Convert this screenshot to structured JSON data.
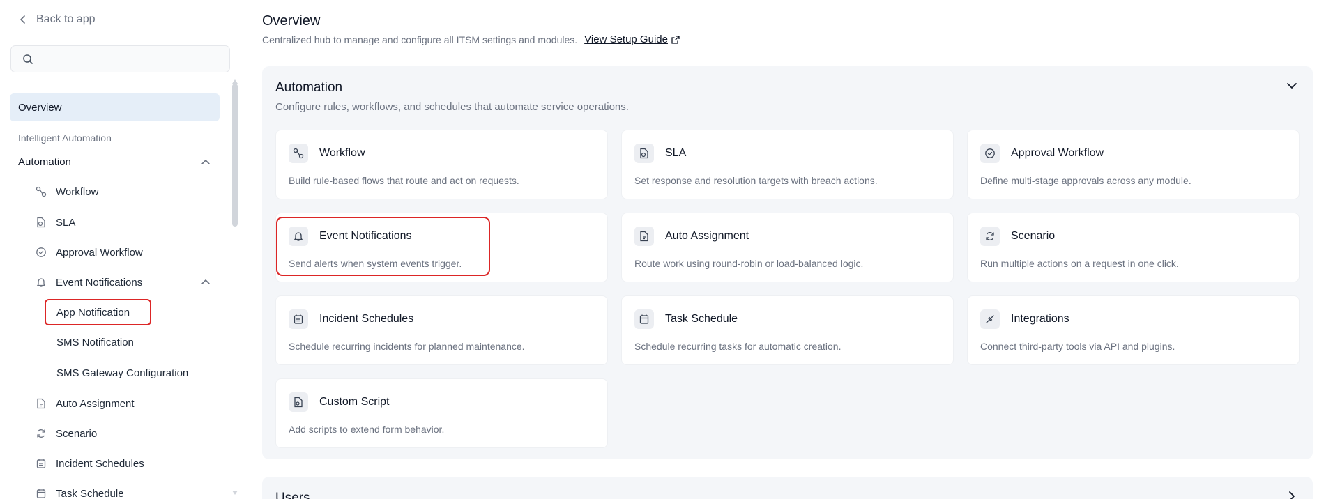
{
  "sidebar": {
    "back_label": "Back to app",
    "search_placeholder": "",
    "overview_label": "Overview",
    "section_label": "Intelligent Automation",
    "group_label": "Automation",
    "items": [
      {
        "label": "Workflow",
        "icon": "workflow-icon"
      },
      {
        "label": "SLA",
        "icon": "sla-icon"
      },
      {
        "label": "Approval Workflow",
        "icon": "approval-icon"
      },
      {
        "label": "Event Notifications",
        "icon": "bell-icon"
      },
      {
        "label": "Auto Assignment",
        "icon": "auto-assign-icon"
      },
      {
        "label": "Scenario",
        "icon": "refresh-icon"
      },
      {
        "label": "Incident Schedules",
        "icon": "calendar-list-icon"
      },
      {
        "label": "Task Schedule",
        "icon": "calendar-icon"
      }
    ],
    "sub_items": [
      {
        "label": "App Notification"
      },
      {
        "label": "SMS Notification"
      },
      {
        "label": "SMS Gateway Configuration"
      }
    ]
  },
  "main": {
    "title": "Overview",
    "subtitle": "Centralized hub to manage and configure all ITSM settings and modules.",
    "guide_label": "View Setup Guide",
    "panel": {
      "title": "Automation",
      "subtitle": "Configure rules, workflows, and schedules that automate service operations.",
      "cards": [
        {
          "title": "Workflow",
          "desc": "Build rule-based flows that route and act on requests.",
          "icon": "workflow-icon"
        },
        {
          "title": "SLA",
          "desc": "Set response and resolution targets with breach actions.",
          "icon": "sla-icon"
        },
        {
          "title": "Approval Workflow",
          "desc": "Define multi-stage approvals across any module.",
          "icon": "approval-icon"
        },
        {
          "title": "Event Notifications",
          "desc": "Send alerts when system events trigger.",
          "icon": "bell-icon"
        },
        {
          "title": "Auto Assignment",
          "desc": "Route work using round-robin or load-balanced logic.",
          "icon": "auto-assign-icon"
        },
        {
          "title": "Scenario",
          "desc": "Run multiple actions on a request in one click.",
          "icon": "refresh-icon"
        },
        {
          "title": "Incident Schedules",
          "desc": "Schedule recurring incidents for planned maintenance.",
          "icon": "calendar-list-icon"
        },
        {
          "title": "Task Schedule",
          "desc": "Schedule recurring tasks for automatic creation.",
          "icon": "calendar-icon"
        },
        {
          "title": "Integrations",
          "desc": "Connect third-party tools via API and plugins.",
          "icon": "plug-icon"
        },
        {
          "title": "Custom Script",
          "desc": "Add scripts to extend form behavior.",
          "icon": "script-icon"
        }
      ]
    },
    "panel2": {
      "title": "Users"
    }
  },
  "colors": {
    "highlight": "#dc2626",
    "active_bg": "#e5eef8"
  }
}
